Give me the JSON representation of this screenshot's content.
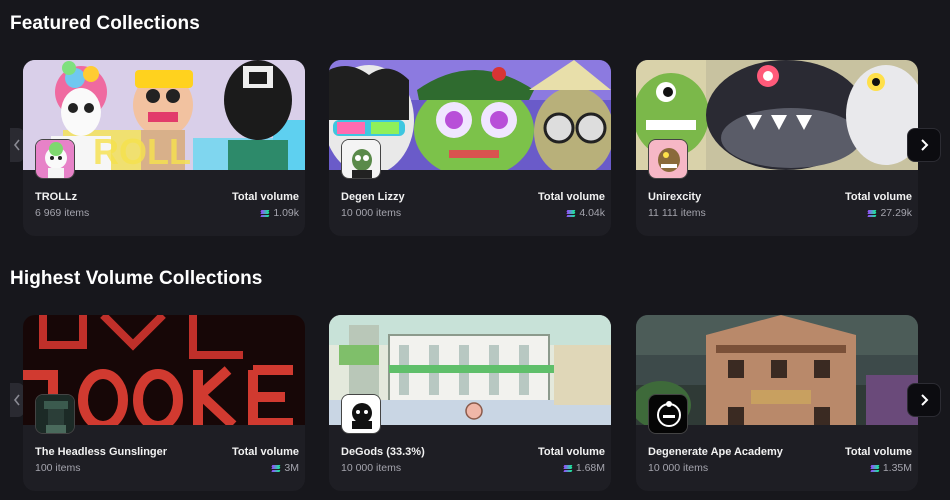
{
  "sections": {
    "featured": {
      "title": "Featured Collections",
      "cards": [
        {
          "name": "TROLLz",
          "items": "6 969 items",
          "volume_label": "Total volume",
          "volume": "1.09k"
        },
        {
          "name": "Degen Lizzy",
          "items": "10 000 items",
          "volume_label": "Total volume",
          "volume": "4.04k"
        },
        {
          "name": "Unirexcity",
          "items": "11 111 items",
          "volume_label": "Total volume",
          "volume": "27.29k"
        }
      ]
    },
    "highest": {
      "title": "Highest Volume Collections",
      "cards": [
        {
          "name": "The Headless Gunslinger",
          "items": "100 items",
          "volume_label": "Total volume",
          "volume": "3M"
        },
        {
          "name": "DeGods (33.3%)",
          "items": "10 000 items",
          "volume_label": "Total volume",
          "volume": "1.68M"
        },
        {
          "name": "Degenerate Ape Academy",
          "items": "10 000 items",
          "volume_label": "Total volume",
          "volume": "1.35M"
        }
      ]
    }
  },
  "icons": {
    "currency": "solana-icon",
    "next": "chevron-right-icon",
    "prev": "chevron-left-icon"
  },
  "colors": {
    "background": "#17171c",
    "card": "#1e1e24",
    "muted_text": "#a4a4ad"
  }
}
